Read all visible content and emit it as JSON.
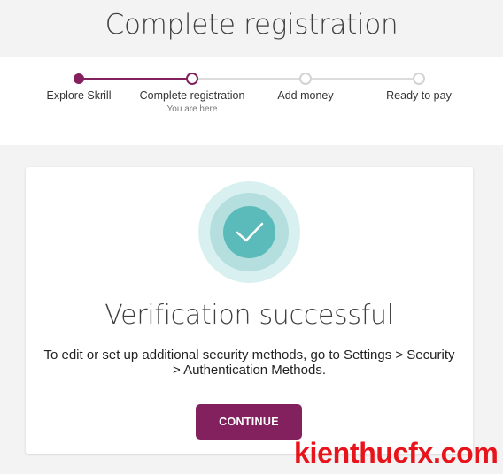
{
  "header": {
    "title": "Complete registration"
  },
  "stepper": {
    "steps": [
      {
        "label": "Explore Skrill",
        "status": "completed"
      },
      {
        "label": "Complete registration",
        "sub": "You are here",
        "status": "current"
      },
      {
        "label": "Add money",
        "status": "pending"
      },
      {
        "label": "Ready to pay",
        "status": "pending"
      }
    ]
  },
  "card": {
    "icon": "checkmark-icon",
    "title": "Verification successful",
    "message": "To edit or set up additional security methods, go to Settings > Security > Authentication Methods.",
    "button_label": "CONTINUE"
  },
  "watermark": {
    "text": "kienthucfx.com"
  },
  "colors": {
    "brand": "#83215e",
    "success_teal": "#5bbbba",
    "watermark_red": "#e8141c"
  }
}
